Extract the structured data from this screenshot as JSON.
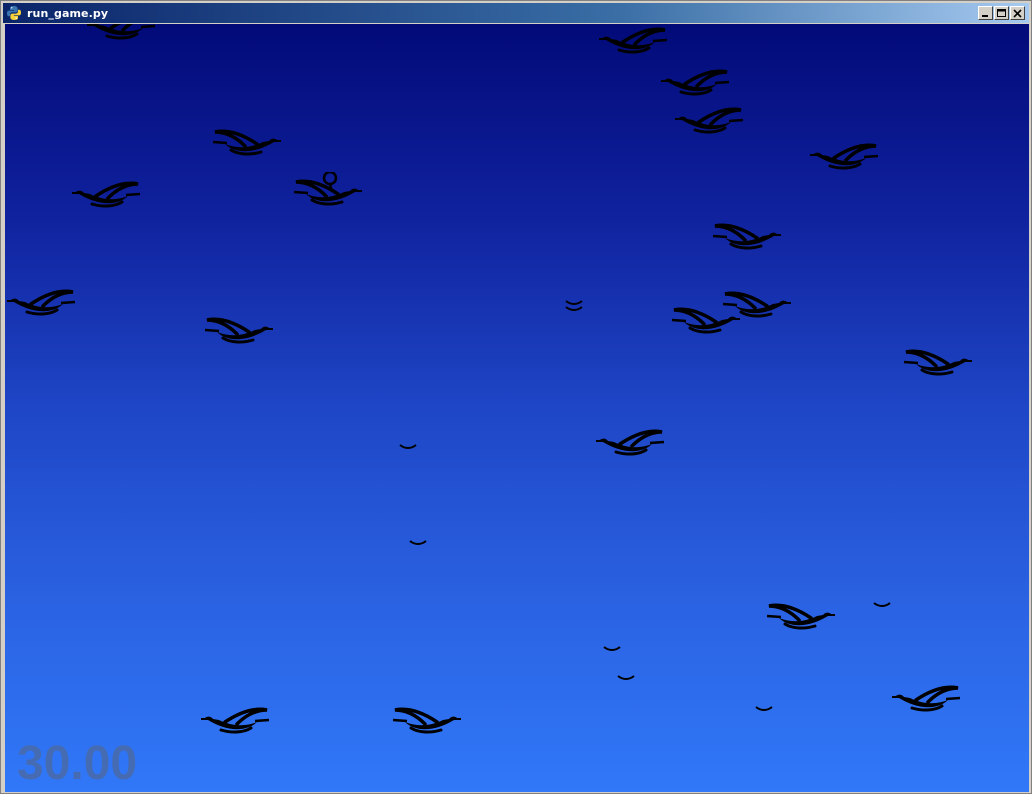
{
  "window": {
    "title": "run_game.py",
    "app_icon": "python-icon",
    "controls": [
      "minimize-icon",
      "maximize-icon",
      "close-icon"
    ]
  },
  "game": {
    "background_top": "#020a78",
    "background_bottom": "#3078f8",
    "bird_color": "#000000",
    "timer_color": "#4a6aa8",
    "hud": {
      "timer": "30.00"
    }
  }
}
